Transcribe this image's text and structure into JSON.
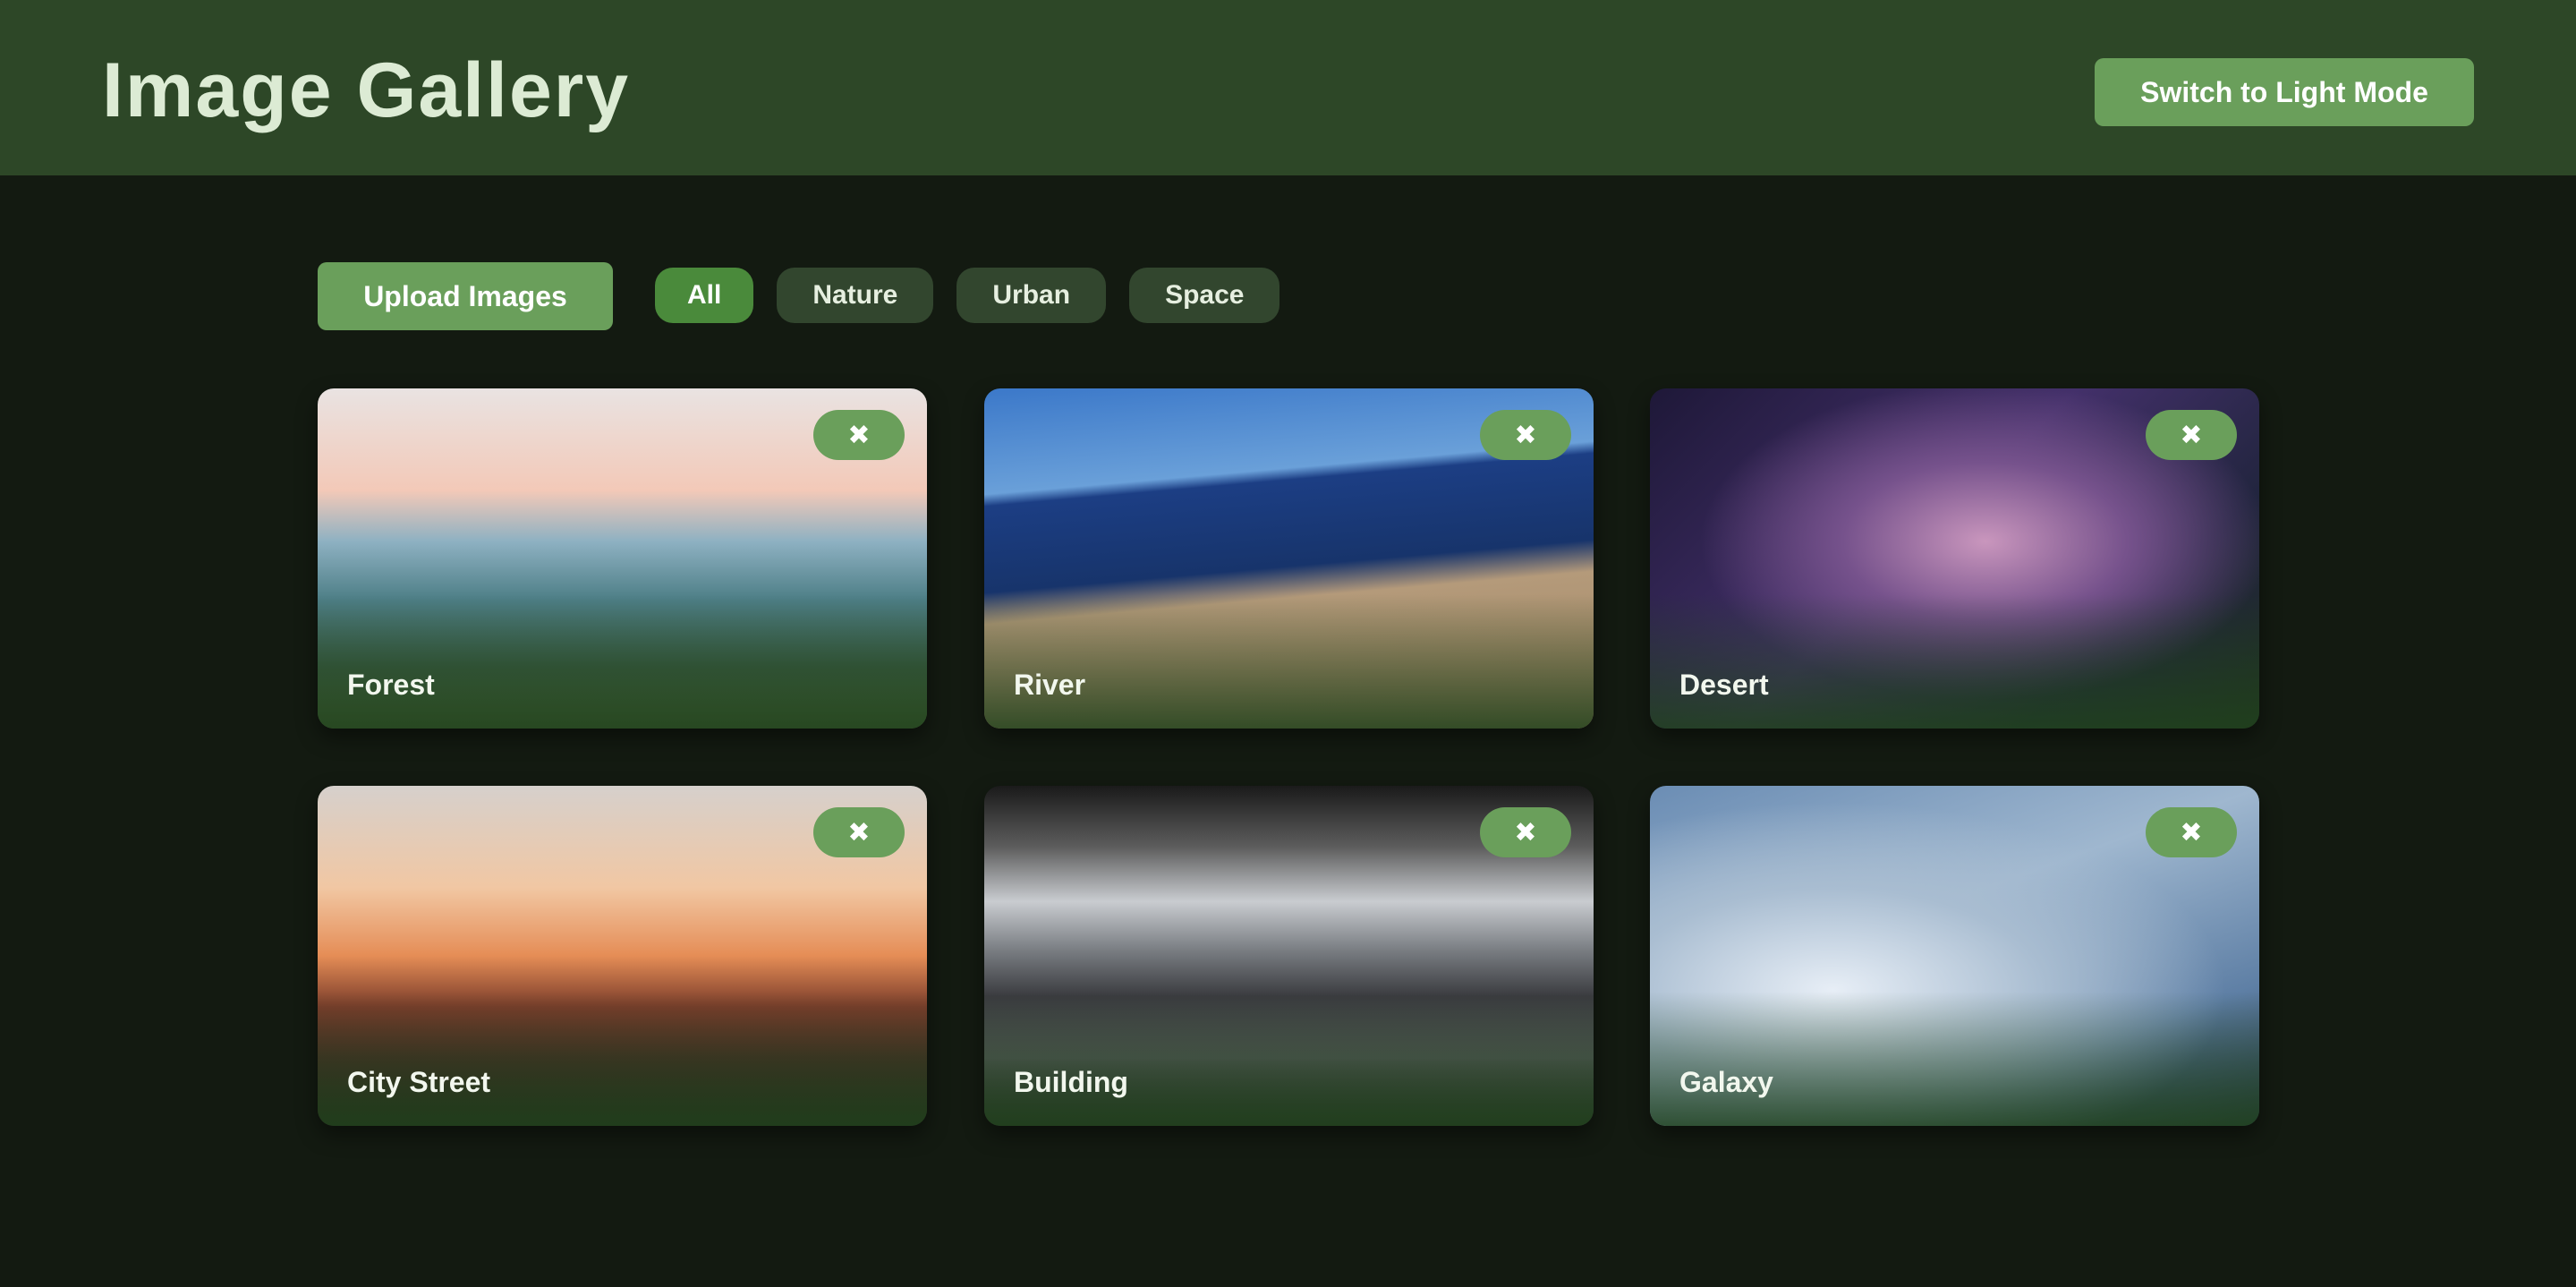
{
  "header": {
    "title": "Image Gallery",
    "mode_button_label": "Switch to Light Mode"
  },
  "toolbar": {
    "upload_label": "Upload Images",
    "filters": [
      {
        "label": "All",
        "active": true
      },
      {
        "label": "Nature",
        "active": false
      },
      {
        "label": "Urban",
        "active": false
      },
      {
        "label": "Space",
        "active": false
      }
    ]
  },
  "gallery": {
    "delete_icon": "x-icon",
    "delete_glyph": "✖",
    "items": [
      {
        "label": "Forest"
      },
      {
        "label": "River"
      },
      {
        "label": "Desert"
      },
      {
        "label": "City Street"
      },
      {
        "label": "Building"
      },
      {
        "label": "Galaxy"
      }
    ]
  },
  "colors": {
    "header_bg": "#2d4727",
    "page_bg": "#131a11",
    "accent": "#6a9f5b",
    "active_filter": "#4a8a3b",
    "inactive_filter": "#32462e",
    "title_text": "#dcebd4"
  }
}
